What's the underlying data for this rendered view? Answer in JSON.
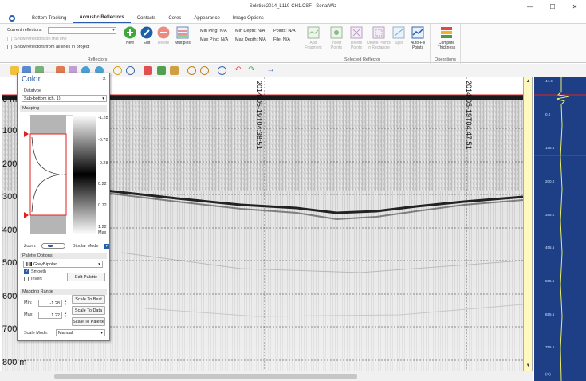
{
  "window": {
    "title": "Solstice2014_L119-CH1.CSF - SonarWiz",
    "minimize": "—",
    "maximize": "☐",
    "close": "✕"
  },
  "tabs": [
    "Bottom Tracking",
    "Acoustic Reflectors",
    "Contacts",
    "Cores",
    "Appearance",
    "Image Options"
  ],
  "ribbon": {
    "reflectors": {
      "current_label": "Current reflectors:",
      "show_on_line": "Show reflectors on this line",
      "show_all": "Show reflectors from all lines in project",
      "group": "Reflectors"
    },
    "buttons": {
      "new": "New",
      "edit": "Edit",
      "delete": "Delete",
      "multiples": "Multiples"
    },
    "stats": {
      "min_ping": "Min Ping: N/A",
      "max_ping": "Max Ping: N/A",
      "min_depth": "Min Depth: N/A",
      "max_depth": "Max Depth: N/A",
      "points": "Points: N/A",
      "file": "File: N/A"
    },
    "selected": {
      "add_fragment": "Add\nFragment",
      "insert_points": "Insert\nPoints",
      "delete_points": "Delete\nPoints",
      "delete_rect": "Delete Points\nin Rectangle",
      "split": "Split",
      "auto_fill": "Auto-Fill\nPoints",
      "group": "Selected Reflector"
    },
    "operations": {
      "compute": "Compute\nThickness",
      "group": "Operations"
    }
  },
  "echogram": {
    "depth_labels": [
      "0 m",
      "100",
      "200",
      "300",
      "400",
      "500",
      "600",
      "700",
      "800 m"
    ],
    "time_marks": [
      "2014-05-19T04:38:51",
      "2014-05-19T04:47:51"
    ]
  },
  "trace": {
    "ticks": [
      "44.4",
      "0.0",
      "155.6",
      "200.0",
      "355.0",
      "455.6",
      "555.6",
      "655.6",
      "755.6",
      "(m)"
    ]
  },
  "color_dialog": {
    "title": "Color",
    "close": "×",
    "datatype_label": "Datatype",
    "datatype_value": "Sub-bottom (ch. 1)",
    "mapping_label": "Mapping",
    "scale_labels": [
      "-1.28",
      "-0.78",
      "-0.28",
      "0.22",
      "0.72",
      "1.22"
    ],
    "scale_max": "Max",
    "zoom_label": "Zoom:",
    "bipolar_mode": "Bipolar Mode",
    "palette_options": "Palette Options",
    "palette_value": "GreyBipolar",
    "smooth": "Smooth",
    "invert": "Invert",
    "edit_palette": "Edit Palette",
    "mapping_range": "Mapping Range",
    "min_label": "Min:",
    "min_value": "-1.28",
    "max_label": "Max:",
    "max_value": "1.22",
    "scale_to_best": "Scale To Best",
    "scale_to_data": "Scale To Data",
    "scale_to_palette": "Scale To Palette",
    "scale_mode_label": "Scale Mode:",
    "scale_mode_value": "Manual"
  },
  "colors": {
    "accent": "#2a5da8",
    "trace_bg": "#1e3f86",
    "scroll_yellow": "#fff9c0",
    "marker_red": "#e02020"
  }
}
